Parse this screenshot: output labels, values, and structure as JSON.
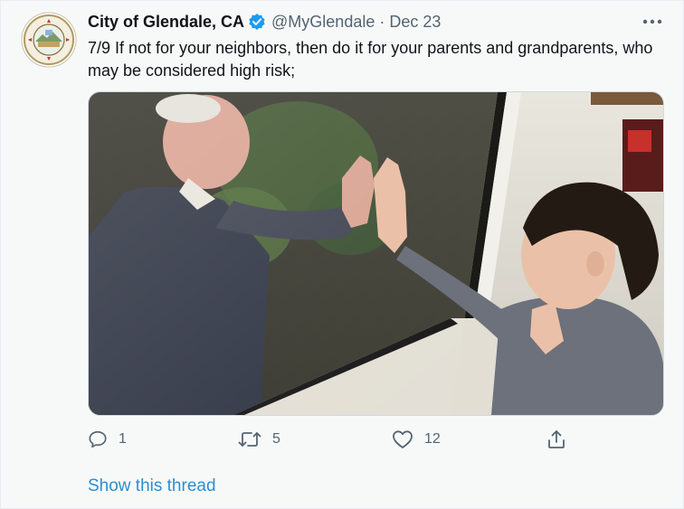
{
  "tweet": {
    "display_name": "City of Glendale, CA",
    "handle": "@MyGlendale",
    "separator": "·",
    "date": "Dec 23",
    "text": "7/9 If not for your neighbors, then do it for your parents and grandparents, who may be considered high risk;",
    "photo_description_icon": "photo-grandparent-and-child-at-window",
    "avatar_text": {
      "top": "CITY OF GLENDALE",
      "bottom": "CALIFORNIA"
    }
  },
  "actions": {
    "reply_count": "1",
    "retweet_count": "5",
    "like_count": "12"
  },
  "footer": {
    "show_thread_label": "Show this thread"
  },
  "colors": {
    "accent": "#1d9bf0",
    "muted": "#536471",
    "background": "#f7f9f9"
  }
}
